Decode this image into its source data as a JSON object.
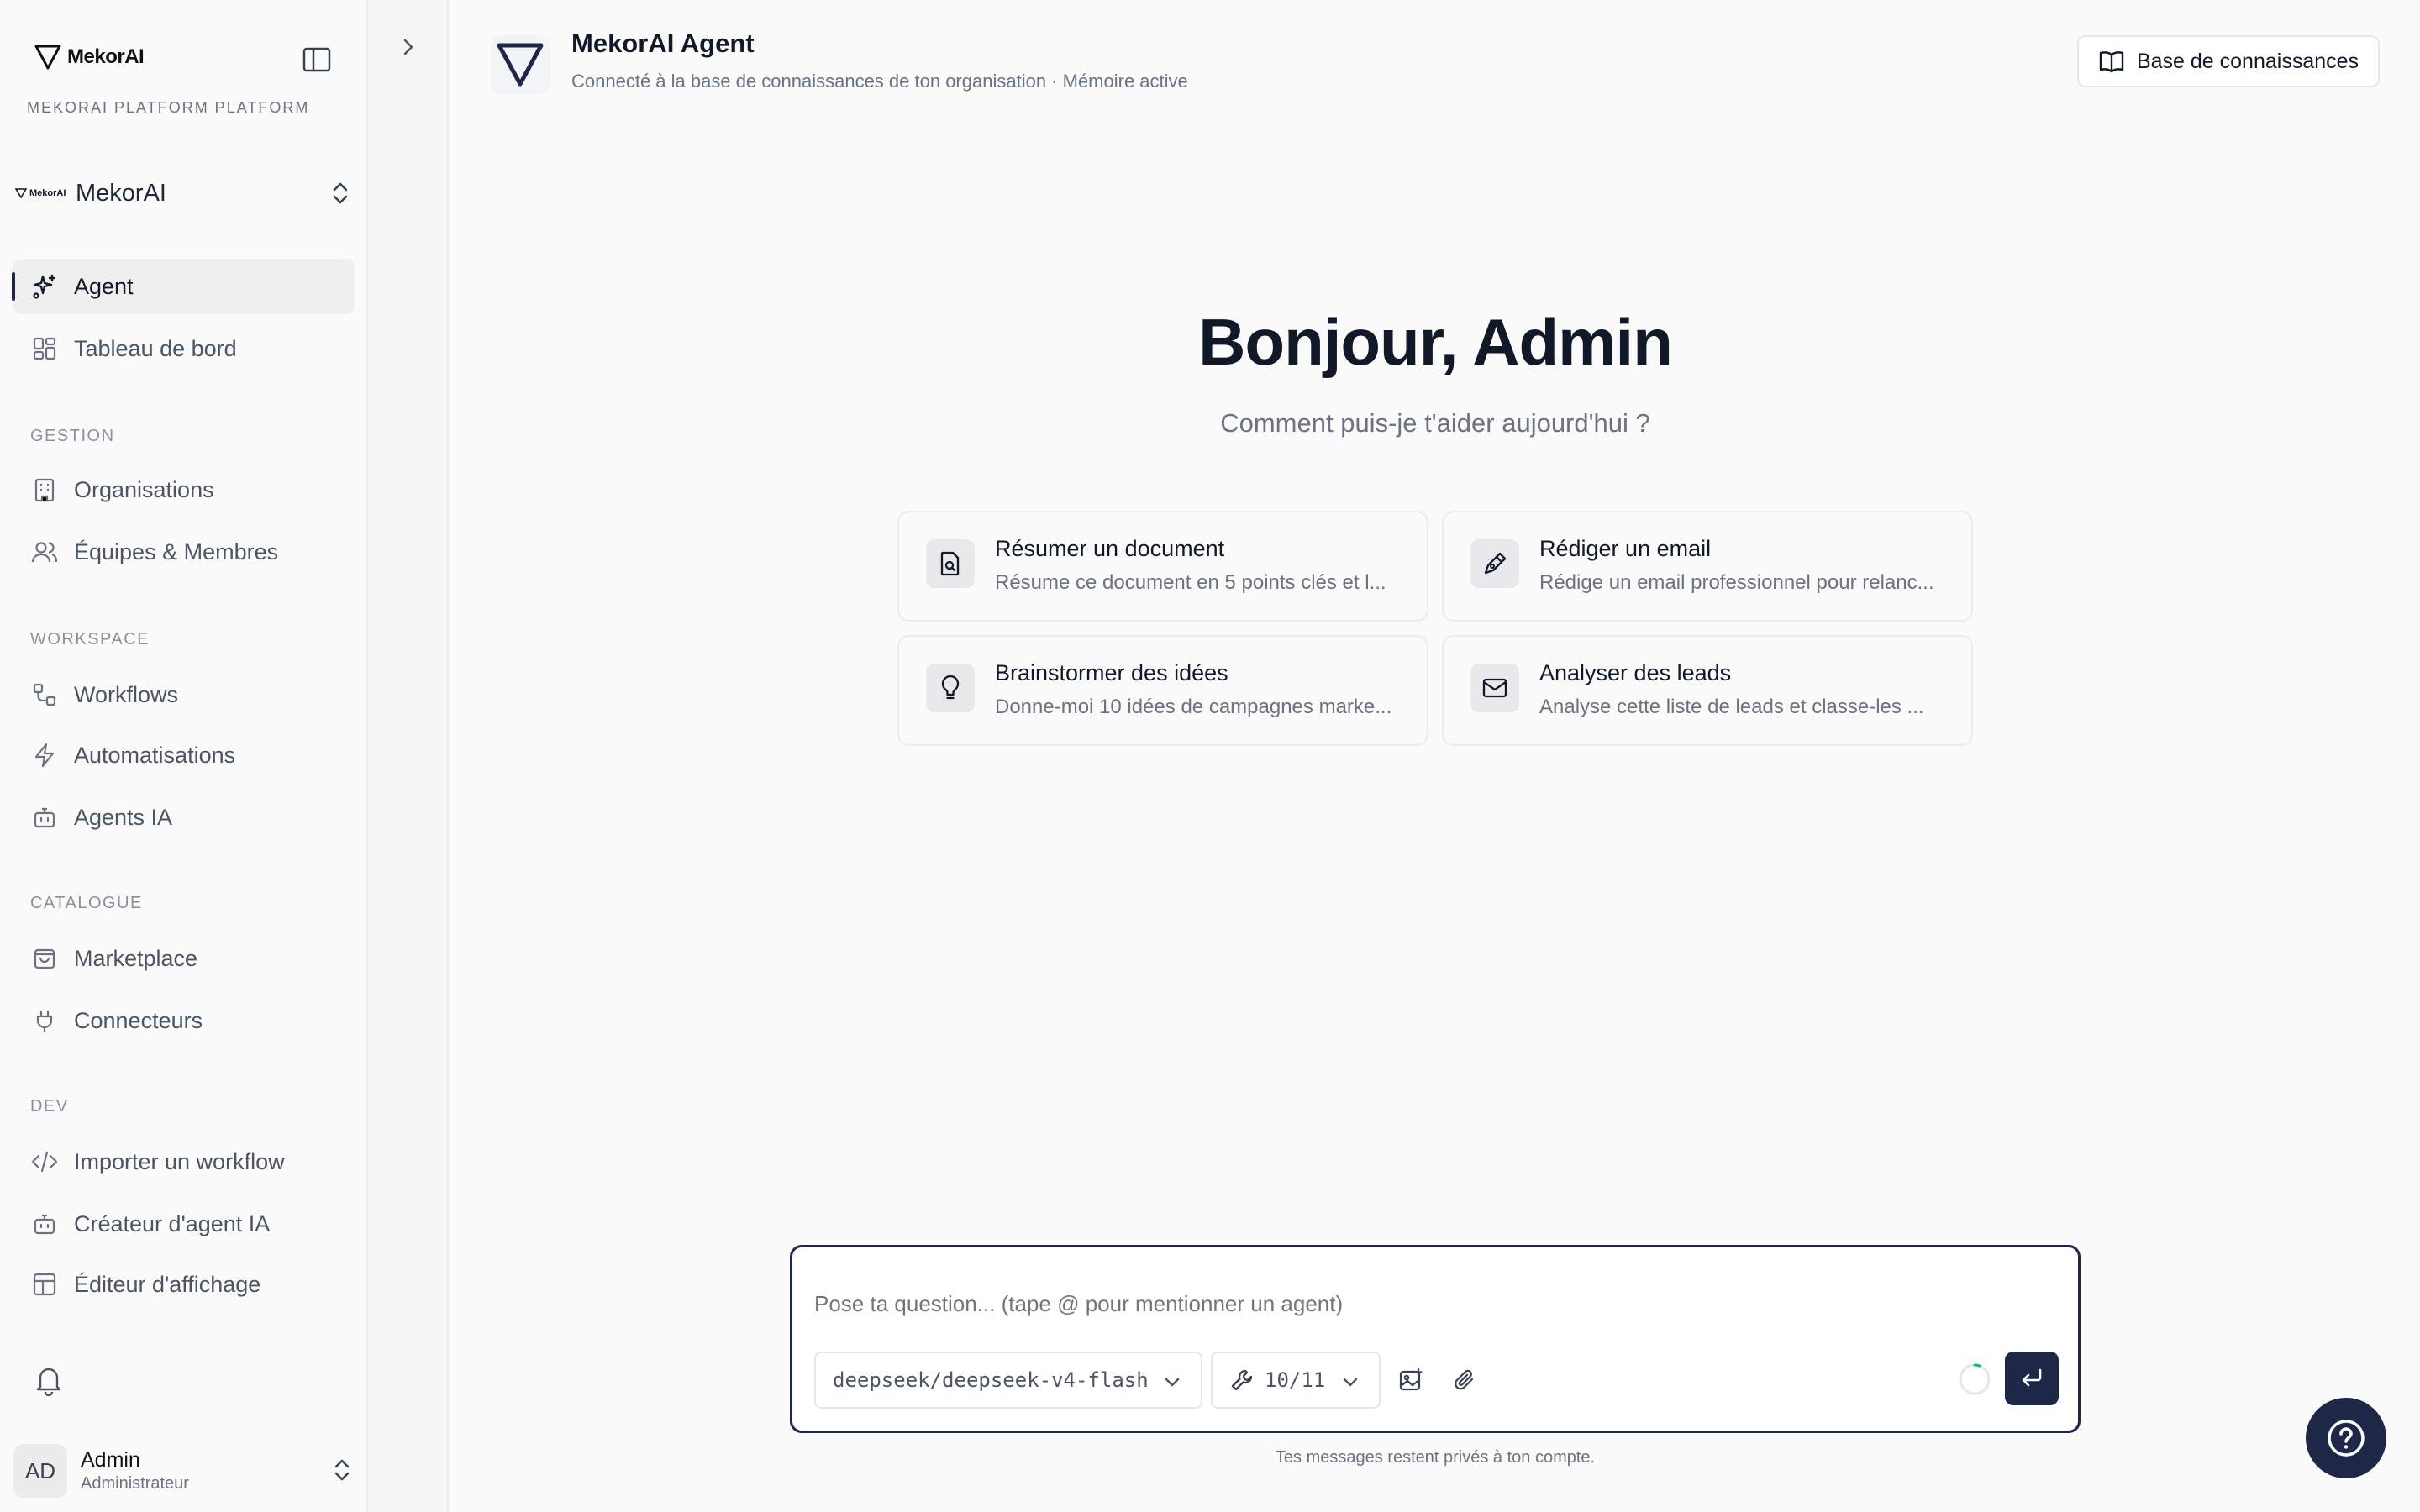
{
  "brand": {
    "logo_text": "MekorAI",
    "platform_label": "MEKORAI PLATFORM PLATFORM"
  },
  "org": {
    "mini_logo": "MekorAI",
    "name": "MekorAI"
  },
  "nav": {
    "agent": "Agent",
    "dashboard": "Tableau de bord",
    "section_gestion": "GESTION",
    "organisations": "Organisations",
    "teams": "Équipes & Membres",
    "section_workspace": "WORKSPACE",
    "workflows": "Workflows",
    "automations": "Automatisations",
    "agents_ia": "Agents IA",
    "section_catalogue": "CATALOGUE",
    "marketplace": "Marketplace",
    "connectors": "Connecteurs",
    "section_dev": "DEV",
    "import_workflow": "Importer un workflow",
    "agent_creator": "Créateur d'agent IA",
    "display_editor": "Éditeur d'affichage"
  },
  "user": {
    "initials": "AD",
    "name": "Admin",
    "role": "Administrateur"
  },
  "header": {
    "title": "MekorAI Agent",
    "subtitle": "Connecté à la base de connaissances de ton organisation · Mémoire active",
    "kb_button": "Base de connaissances"
  },
  "greeting": {
    "title": "Bonjour, Admin",
    "subtitle": "Comment puis-je t'aider aujourd'hui ?"
  },
  "suggestions": [
    {
      "title": "Résumer un document",
      "desc": "Résume ce document en 5 points clés et l...",
      "icon": "document-search-icon"
    },
    {
      "title": "Rédiger un email",
      "desc": "Rédige un email professionnel pour relanc...",
      "icon": "pen-icon"
    },
    {
      "title": "Brainstormer des idées",
      "desc": "Donne-moi 10 idées de campagnes marke...",
      "icon": "lightbulb-icon"
    },
    {
      "title": "Analyser des leads",
      "desc": "Analyse cette liste de leads et classe-les ...",
      "icon": "mail-icon"
    }
  ],
  "composer": {
    "placeholder": "Pose ta question... (tape @ pour mentionner un agent)",
    "model": "deepseek/deepseek-v4-flash",
    "tools_count": "10/11"
  },
  "footer": {
    "privacy": "Tes messages restent privés à ton compte."
  },
  "colors": {
    "accent": "#1e2748",
    "muted": "#6b7280"
  }
}
